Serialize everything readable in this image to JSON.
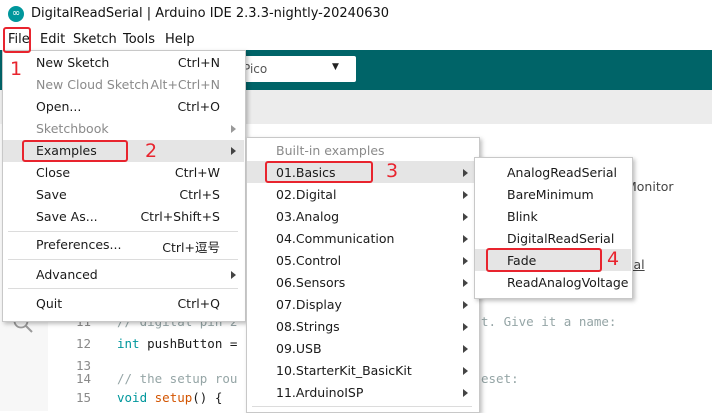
{
  "window": {
    "title": "DigitalReadSerial | Arduino IDE 2.3.3-nightly-20240630",
    "icon": "arduino-logo-icon"
  },
  "menubar": [
    "File",
    "Edit",
    "Sketch",
    "Tools",
    "Help"
  ],
  "toolbar": {
    "board": "Pico"
  },
  "editor": {
    "right_text_1": "Monitor",
    "right_text_2": "ial",
    "lines": [
      {
        "num": "11",
        "text": "// digital pin 2",
        "tail": "t. Give it a name:"
      },
      {
        "num": "12",
        "text": "int pushButton ="
      },
      {
        "num": "13",
        "text": ""
      },
      {
        "num": "14",
        "text": "// the setup rou",
        "tail": "eset:"
      },
      {
        "num": "15",
        "text": "void setup() {"
      }
    ]
  },
  "file_menu": {
    "items": [
      {
        "label": "New Sketch",
        "shortcut": "Ctrl+N"
      },
      {
        "label": "New Cloud Sketch",
        "shortcut": "Alt+Ctrl+N"
      },
      {
        "label": "Open...",
        "shortcut": "Ctrl+O"
      },
      {
        "label": "Sketchbook",
        "shortcut": "",
        "submenu": true,
        "disabled": true
      },
      {
        "label": "Examples",
        "shortcut": "",
        "submenu": true
      },
      {
        "label": "Close",
        "shortcut": "Ctrl+W"
      },
      {
        "label": "Save",
        "shortcut": "Ctrl+S"
      },
      {
        "label": "Save As...",
        "shortcut": "Ctrl+Shift+S"
      },
      {
        "label": "Preferences...",
        "shortcut": "Ctrl+逗号"
      },
      {
        "label": "Advanced",
        "shortcut": "",
        "submenu": true
      },
      {
        "label": "Quit",
        "shortcut": "Ctrl+Q"
      }
    ]
  },
  "examples_menu": {
    "header": "Built-in examples",
    "items": [
      "01.Basics",
      "02.Digital",
      "03.Analog",
      "04.Communication",
      "05.Control",
      "06.Sensors",
      "07.Display",
      "08.Strings",
      "09.USB",
      "10.StarterKit_BasicKit",
      "11.ArduinoISP"
    ]
  },
  "basics_menu": {
    "items": [
      "AnalogReadSerial",
      "BareMinimum",
      "Blink",
      "DigitalReadSerial",
      "Fade",
      "ReadAnalogVoltage"
    ]
  },
  "annotations": [
    "1",
    "2",
    "3",
    "4"
  ],
  "colors": {
    "toolbar": "#006468",
    "accent": "#00979c",
    "annotation_red": "#e8242e"
  }
}
